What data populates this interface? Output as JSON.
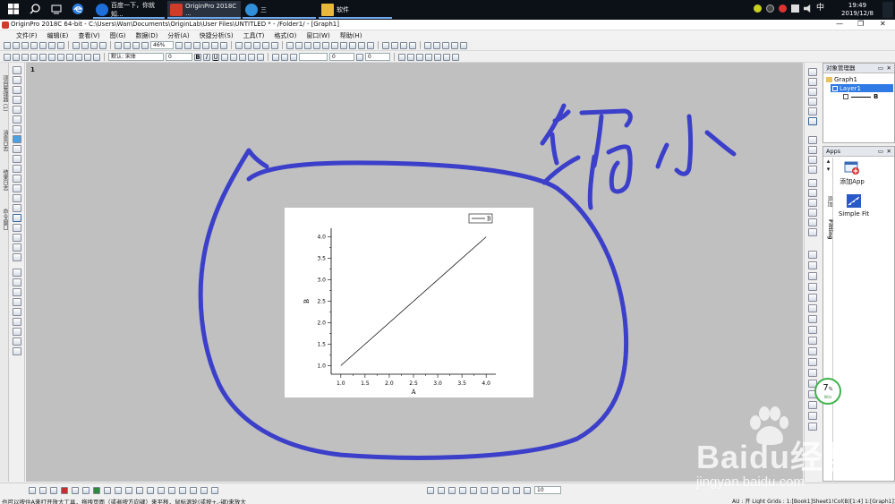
{
  "taskbar": {
    "tasks": [
      {
        "label": "百度一下，你就知...",
        "icon": "browser-icon",
        "color": "#1e6fd9"
      },
      {
        "label": "OriginPro 2018C ...",
        "icon": "originpro-icon",
        "color": "#d23a2a"
      },
      {
        "label": "三",
        "icon": "app-icon",
        "color": "#2f8fd8"
      },
      {
        "label": "软件",
        "icon": "folder-icon",
        "color": "#e8b838"
      }
    ],
    "tray_ime": "中",
    "time": "19:49",
    "date": "2019/12/8"
  },
  "window": {
    "title": "OriginPro 2018C 64-bit - C:\\Users\\Wan\\Documents\\OriginLab\\User Files\\UNTITLED * - /Folder1/ - [Graph1]"
  },
  "menu": [
    "文件(F)",
    "编辑(E)",
    "查看(V)",
    "图(G)",
    "数据(D)",
    "分析(A)",
    "快捷分析(S)",
    "工具(T)",
    "格式(O)",
    "窗口(W)",
    "帮助(H)"
  ],
  "toolbar": {
    "zoom_value": "46%",
    "font_combo": "默认: 宋体",
    "font_size": "0",
    "line_width": "0"
  },
  "left_dock_tabs": [
    "项目管理器 (1)",
    "消息日志",
    "结果日志",
    "命令窗口"
  ],
  "graph": {
    "layer_number": "1"
  },
  "chart_data": {
    "type": "line",
    "series": [
      {
        "name": "B",
        "x": [
          1.0,
          4.0
        ],
        "y": [
          1.0,
          4.0
        ],
        "color": "#000000"
      }
    ],
    "xlabel": "A",
    "ylabel": "B",
    "xlim": [
      0.8,
      4.2
    ],
    "ylim": [
      0.8,
      4.2
    ],
    "xticks": [
      "1.0",
      "1.5",
      "2.0",
      "2.5",
      "3.0",
      "3.5",
      "4.0"
    ],
    "yticks": [
      "1.0",
      "1.5",
      "2.0",
      "2.5",
      "3.0",
      "3.5",
      "4.0"
    ],
    "legend_position": "top-right"
  },
  "object_manager": {
    "title": "对象管理器",
    "graph": "Graph1",
    "layer": "Layer1",
    "plot": "B"
  },
  "apps_panel": {
    "title": "Apps",
    "items": [
      {
        "label": "添加App"
      },
      {
        "label": "Simple Fit"
      }
    ],
    "side_tabs": [
      "添加",
      "Fitting"
    ]
  },
  "status": {
    "left_text": "也可以按住A来打开放大工具，拖拽页面（或者按方向键）来平移，鼠标滚轮(或按+,-键)来放大",
    "right_text": "AU : 开  Light Grids : 1:[Book1]Sheet1!Col(B)[1:4]  1:[Graph1]1!1  弧度",
    "zoom_combo": "10"
  },
  "overlay": {
    "handwriting_text": "缩小",
    "ink_color": "#3b3fc9",
    "speed_widget_value": "7",
    "speed_widget_unit": "%",
    "speed_widget_sub": "0K/s"
  },
  "watermark": {
    "brand": "Baidu经验",
    "url": "jingyan.baidu.com"
  }
}
